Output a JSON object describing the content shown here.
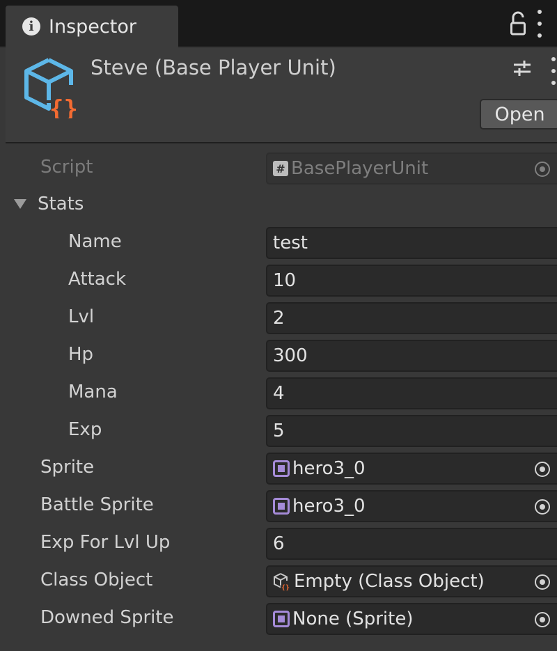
{
  "tab": {
    "label": "Inspector",
    "icon": "info-icon"
  },
  "header": {
    "title": "Steve (Base Player Unit)",
    "open_label": "Open",
    "icon": "scriptable-object-icon"
  },
  "colors": {
    "background": "#383838",
    "field": "#2a2a2a",
    "tabbar": "#191919",
    "asset_icon_blue": "#5db7e8",
    "asset_icon_orange": "#f36b32",
    "sprite_icon": "#a58bd8"
  },
  "properties": {
    "script": {
      "label": "Script",
      "value": "BasePlayerUnit",
      "icon": "csharp-script-icon"
    },
    "stats": {
      "label": "Stats",
      "name": {
        "label": "Name",
        "value": "test"
      },
      "attack": {
        "label": "Attack",
        "value": "10"
      },
      "lvl": {
        "label": "Lvl",
        "value": "2"
      },
      "hp": {
        "label": "Hp",
        "value": "300"
      },
      "mana": {
        "label": "Mana",
        "value": "4"
      },
      "exp": {
        "label": "Exp",
        "value": "5"
      }
    },
    "sprite": {
      "label": "Sprite",
      "value": "hero3_0",
      "icon": "sprite-icon"
    },
    "battle_sprite": {
      "label": "Battle Sprite",
      "value": "hero3_0",
      "icon": "sprite-icon"
    },
    "exp_for_lvl_up": {
      "label": "Exp For Lvl Up",
      "value": "6"
    },
    "class_object": {
      "label": "Class Object",
      "value": "Empty (Class Object)",
      "icon": "scriptable-object-icon"
    },
    "downed_sprite": {
      "label": "Downed Sprite",
      "value": "None (Sprite)",
      "icon": "sprite-icon"
    }
  }
}
